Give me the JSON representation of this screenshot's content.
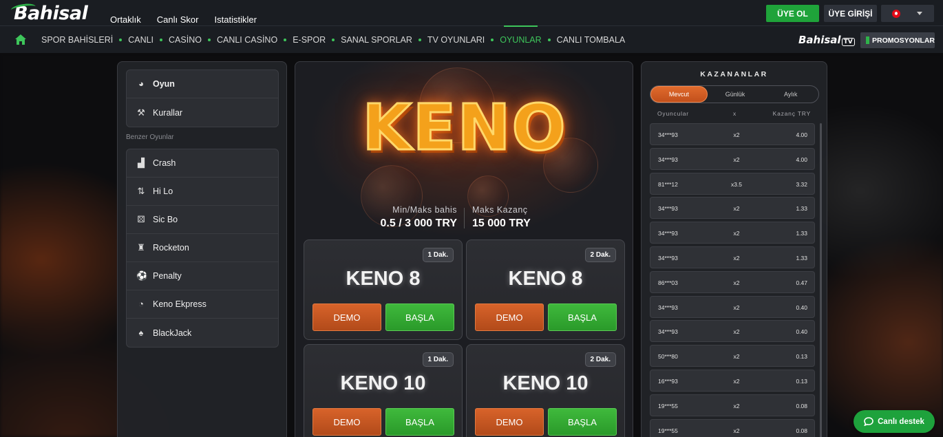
{
  "brand": {
    "logo": "Bahisal",
    "tv_logo": "Bahisal",
    "tv_badge": "TV",
    "accent": "#3ec65b"
  },
  "top_nav": [
    "Ortaklık",
    "Canlı Skor",
    "Istatistikler"
  ],
  "auth": {
    "register": "ÜYE OL",
    "login": "ÜYE GİRİŞİ"
  },
  "language": {
    "flag_icon": "turkey-flag-icon"
  },
  "main_nav": [
    {
      "label": "SPOR BAHİSLERİ",
      "active": false
    },
    {
      "label": "CANLI",
      "active": false
    },
    {
      "label": "CASİNO",
      "active": false
    },
    {
      "label": "CANLI CASİNO",
      "active": false
    },
    {
      "label": "E-SPOR",
      "active": false
    },
    {
      "label": "SANAL SPORLAR",
      "active": false
    },
    {
      "label": "TV OYUNLARI",
      "active": false
    },
    {
      "label": "OYUNLAR",
      "active": true
    },
    {
      "label": "CANLI TOMBALA",
      "active": false
    }
  ],
  "promotions": "PROMOSYONLAR",
  "sidebar": {
    "top_items": [
      {
        "label": "Oyun",
        "icon": "game-icon"
      },
      {
        "label": "Kurallar",
        "icon": "gavel-icon"
      }
    ],
    "similar_label": "Benzer Oyunlar",
    "similar_items": [
      {
        "label": "Crash",
        "icon": "chart-icon"
      },
      {
        "label": "Hi Lo",
        "icon": "updown-icon"
      },
      {
        "label": "Sic Bo",
        "icon": "dice-icon"
      },
      {
        "label": "Rocketon",
        "icon": "rocket-icon"
      },
      {
        "label": "Penalty",
        "icon": "ball-icon"
      },
      {
        "label": "Keno Ekpress",
        "icon": "keno-icon"
      },
      {
        "label": "BlackJack",
        "icon": "cards-icon"
      }
    ]
  },
  "game": {
    "title": "KENO",
    "min_max_label": "Min/Maks bahis",
    "min_max_value": "0.5 / 3 000  TRY",
    "max_win_label": "Maks Kazanç",
    "max_win_value": "15 000  TRY",
    "cards": [
      {
        "title": "KENO 8",
        "badge": "1 Dak.",
        "demo": "DEMO",
        "play": "BAŞLA"
      },
      {
        "title": "KENO 8",
        "badge": "2 Dak.",
        "demo": "DEMO",
        "play": "BAŞLA"
      },
      {
        "title": "KENO 10",
        "badge": "1 Dak.",
        "demo": "DEMO",
        "play": "BAŞLA"
      },
      {
        "title": "KENO 10",
        "badge": "2 Dak.",
        "demo": "DEMO",
        "play": "BAŞLA"
      }
    ]
  },
  "winners": {
    "title": "KAZANANLAR",
    "tabs": [
      {
        "label": "Mevcut",
        "active": true
      },
      {
        "label": "Günlük",
        "active": false
      },
      {
        "label": "Aylık",
        "active": false
      }
    ],
    "columns": {
      "player": "Oyuncular",
      "x": "x",
      "win": "Kazanç TRY"
    },
    "rows": [
      {
        "user": "34***93",
        "x": "x2",
        "win": "4.00"
      },
      {
        "user": "34***93",
        "x": "x2",
        "win": "4.00"
      },
      {
        "user": "81***12",
        "x": "x3.5",
        "win": "3.32"
      },
      {
        "user": "34***93",
        "x": "x2",
        "win": "1.33"
      },
      {
        "user": "34***93",
        "x": "x2",
        "win": "1.33"
      },
      {
        "user": "34***93",
        "x": "x2",
        "win": "1.33"
      },
      {
        "user": "86***03",
        "x": "x2",
        "win": "0.47"
      },
      {
        "user": "34***93",
        "x": "x2",
        "win": "0.40"
      },
      {
        "user": "34***93",
        "x": "x2",
        "win": "0.40"
      },
      {
        "user": "50***80",
        "x": "x2",
        "win": "0.13"
      },
      {
        "user": "16***93",
        "x": "x2",
        "win": "0.13"
      },
      {
        "user": "19***55",
        "x": "x2",
        "win": "0.08"
      },
      {
        "user": "19***55",
        "x": "x2",
        "win": "0.08"
      }
    ]
  },
  "live_support": "Canlı destek"
}
